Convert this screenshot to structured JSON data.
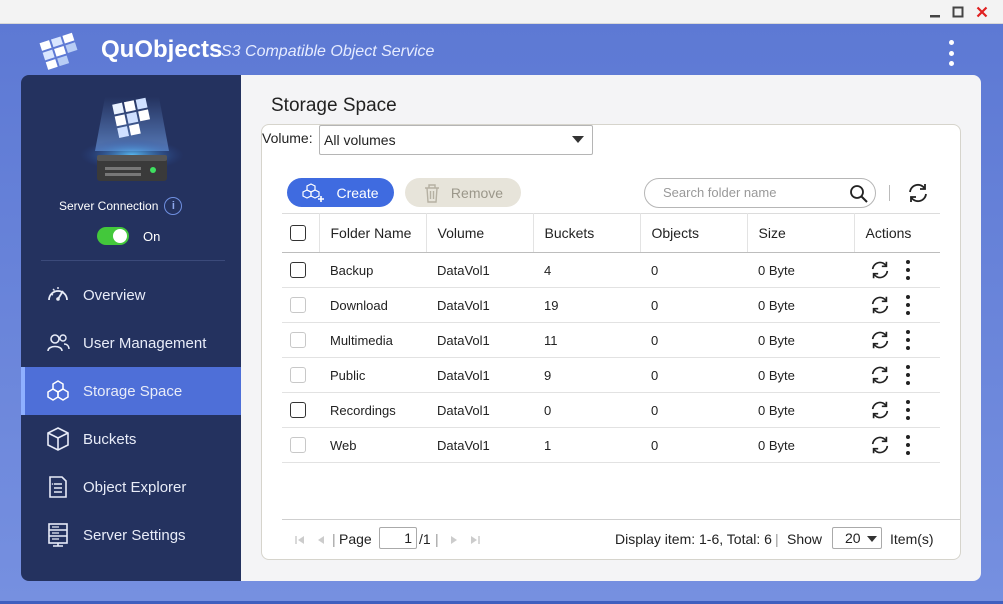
{
  "app": {
    "name": "QuObjects",
    "subtitle": "S3 Compatible Object Service"
  },
  "sidebar": {
    "server_connection_label": "Server Connection",
    "server_connection_state": "On",
    "items": [
      {
        "label": "Overview",
        "icon": "gauge-icon"
      },
      {
        "label": "User Management",
        "icon": "users-icon"
      },
      {
        "label": "Storage Space",
        "icon": "cubes-icon",
        "active": true
      },
      {
        "label": "Buckets",
        "icon": "cube-icon"
      },
      {
        "label": "Object Explorer",
        "icon": "document-list-icon"
      },
      {
        "label": "Server Settings",
        "icon": "server-settings-icon"
      }
    ]
  },
  "page": {
    "title": "Storage Space",
    "volume_label": "Volume:",
    "volume_value": "All volumes",
    "create_label": "Create",
    "remove_label": "Remove",
    "search_placeholder": "Search folder name"
  },
  "table": {
    "headers": [
      "Folder Name",
      "Volume",
      "Buckets",
      "Objects",
      "Size",
      "Actions"
    ],
    "rows": [
      {
        "folder": "Backup",
        "volume": "DataVol1",
        "buckets": "4",
        "objects": "0",
        "size": "0 Byte"
      },
      {
        "folder": "Download",
        "volume": "DataVol1",
        "buckets": "19",
        "objects": "0",
        "size": "0 Byte"
      },
      {
        "folder": "Multimedia",
        "volume": "DataVol1",
        "buckets": "11",
        "objects": "0",
        "size": "0 Byte"
      },
      {
        "folder": "Public",
        "volume": "DataVol1",
        "buckets": "9",
        "objects": "0",
        "size": "0 Byte"
      },
      {
        "folder": "Recordings",
        "volume": "DataVol1",
        "buckets": "0",
        "objects": "0",
        "size": "0 Byte"
      },
      {
        "folder": "Web",
        "volume": "DataVol1",
        "buckets": "1",
        "objects": "0",
        "size": "0 Byte"
      }
    ]
  },
  "pagination": {
    "page_label": "Page",
    "page_value": "1",
    "page_total": "/1",
    "display_text": "Display item: 1-6, Total: 6",
    "show_label": "Show",
    "show_value": "20",
    "items_label": "Item(s)"
  },
  "colors": {
    "accent": "#3f6be0",
    "sidebar_bg": "#24325f",
    "sidebar_active": "#4e6fd8",
    "toggle_on": "#43c83b",
    "close_red": "#e02020"
  }
}
